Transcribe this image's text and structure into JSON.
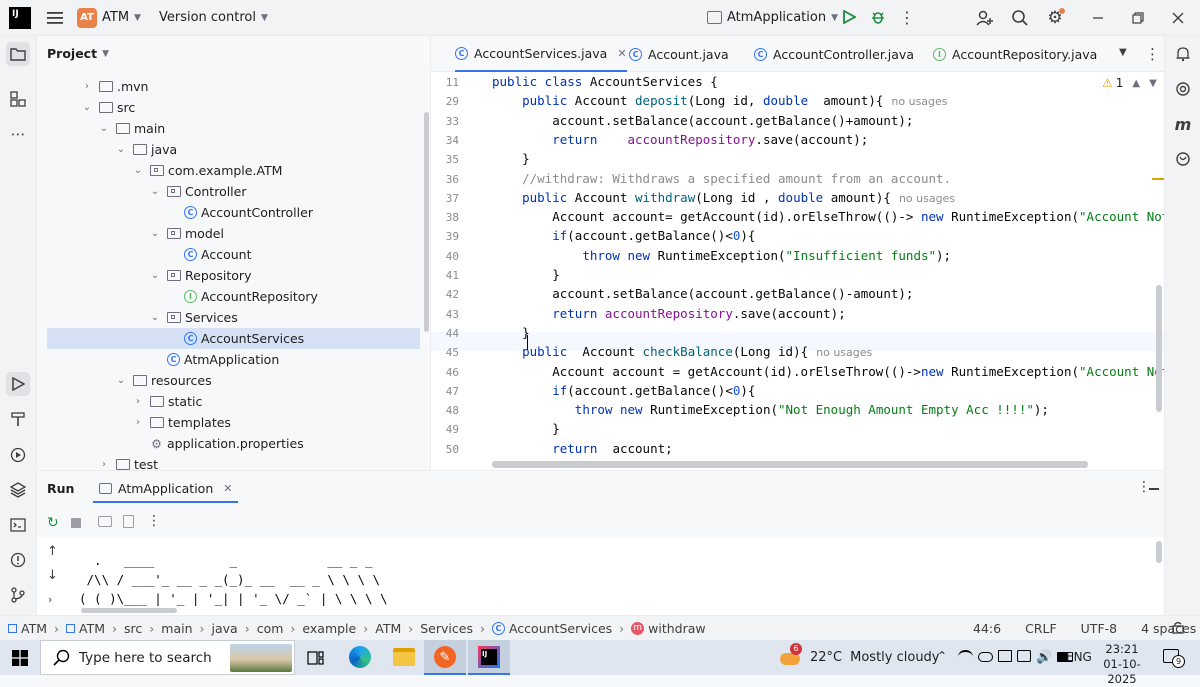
{
  "titlebar": {
    "logo": "IJ",
    "project_badge": "AT",
    "project_name": "ATM",
    "vcs": "Version control",
    "run_config": "AtmApplication"
  },
  "project_panel": {
    "title": "Project",
    "tree": [
      {
        "label": ".mvn",
        "type": "folder",
        "indent": 0,
        "open": false
      },
      {
        "label": "src",
        "type": "folder",
        "indent": 0,
        "open": true
      },
      {
        "label": "main",
        "type": "folder",
        "indent": 1,
        "open": true
      },
      {
        "label": "java",
        "type": "folder",
        "indent": 2,
        "open": true
      },
      {
        "label": "com.example.ATM",
        "type": "package",
        "indent": 3,
        "open": true
      },
      {
        "label": "Controller",
        "type": "package",
        "indent": 4,
        "open": true
      },
      {
        "label": "AccountController",
        "type": "class",
        "indent": 5
      },
      {
        "label": "model",
        "type": "package",
        "indent": 4,
        "open": true
      },
      {
        "label": "Account",
        "type": "class",
        "indent": 5
      },
      {
        "label": "Repository",
        "type": "package",
        "indent": 4,
        "open": true
      },
      {
        "label": "AccountRepository",
        "type": "interface",
        "indent": 5
      },
      {
        "label": "Services",
        "type": "package",
        "indent": 4,
        "open": true
      },
      {
        "label": "AccountServices",
        "type": "class",
        "indent": 5,
        "selected": true
      },
      {
        "label": "AtmApplication",
        "type": "class",
        "indent": 4
      },
      {
        "label": "resources",
        "type": "folder",
        "indent": 2,
        "open": true
      },
      {
        "label": "static",
        "type": "folder",
        "indent": 3
      },
      {
        "label": "templates",
        "type": "folder",
        "indent": 3
      },
      {
        "label": "application.properties",
        "type": "gear",
        "indent": 3
      },
      {
        "label": "test",
        "type": "folder",
        "indent": 1,
        "open": false
      }
    ]
  },
  "tabs": [
    {
      "label": "AccountServices.java",
      "icon": "class",
      "active": true
    },
    {
      "label": "Account.java",
      "icon": "class"
    },
    {
      "label": "AccountController.java",
      "icon": "class"
    },
    {
      "label": "AccountRepository.java",
      "icon": "interface"
    }
  ],
  "editor": {
    "warning_count": "1",
    "lines": [
      {
        "n": "11",
        "segs": [
          [
            "kw",
            "public class "
          ],
          [
            "",
            "AccountServices {"
          ]
        ]
      },
      {
        "n": "29",
        "segs": [
          [
            "",
            "    "
          ],
          [
            "kw",
            "public "
          ],
          [
            "",
            "Account "
          ],
          [
            "fn",
            "deposit"
          ],
          [
            "",
            "(Long id, "
          ],
          [
            "kw",
            "double  "
          ],
          [
            "",
            "amount){"
          ],
          [
            "hint",
            "no usages"
          ]
        ]
      },
      {
        "n": "33",
        "segs": [
          [
            "",
            "        account.setBalance(account.getBalance()+amount);"
          ]
        ]
      },
      {
        "n": "34",
        "segs": [
          [
            "",
            "        "
          ],
          [
            "kw",
            "return    "
          ],
          [
            "fld",
            "accountRepository"
          ],
          [
            "",
            ".save(account);"
          ]
        ]
      },
      {
        "n": "35",
        "segs": [
          [
            "",
            "    }"
          ]
        ]
      },
      {
        "n": "36",
        "segs": [
          [
            "cm",
            "    //withdraw: Withdraws a specified amount from an account."
          ]
        ]
      },
      {
        "n": "37",
        "segs": [
          [
            "",
            "    "
          ],
          [
            "kw",
            "public "
          ],
          [
            "",
            "Account "
          ],
          [
            "fn",
            "withdraw"
          ],
          [
            "",
            "(Long id , "
          ],
          [
            "kw",
            "double "
          ],
          [
            "",
            "amount){"
          ],
          [
            "hint",
            "no usages"
          ]
        ]
      },
      {
        "n": "38",
        "segs": [
          [
            "",
            "        Account account= getAccount(id).orElseThrow(()-> "
          ],
          [
            "kw",
            "new "
          ],
          [
            "",
            "RuntimeException("
          ],
          [
            "str",
            "\"Account Not Found"
          ]
        ]
      },
      {
        "n": "39",
        "segs": [
          [
            "",
            "        "
          ],
          [
            "kw",
            "if"
          ],
          [
            "",
            "(account.getBalance()<"
          ],
          [
            "num",
            "0"
          ],
          [
            "",
            "){"
          ]
        ]
      },
      {
        "n": "40",
        "segs": [
          [
            "",
            "            "
          ],
          [
            "kw",
            "throw new "
          ],
          [
            "",
            "RuntimeException("
          ],
          [
            "str",
            "\"Insufficient funds\""
          ],
          [
            "",
            ");"
          ]
        ]
      },
      {
        "n": "41",
        "segs": [
          [
            "",
            "        }"
          ]
        ]
      },
      {
        "n": "42",
        "segs": [
          [
            "",
            "        account.setBalance(account.getBalance()-amount);"
          ]
        ]
      },
      {
        "n": "43",
        "segs": [
          [
            "",
            "        "
          ],
          [
            "kw",
            "return "
          ],
          [
            "fld",
            "accountRepository"
          ],
          [
            "",
            ".save(account);"
          ]
        ]
      },
      {
        "n": "44",
        "segs": [
          [
            "",
            "    }"
          ]
        ]
      },
      {
        "n": "45",
        "segs": [
          [
            "",
            "    "
          ],
          [
            "kw",
            "public  "
          ],
          [
            "",
            "Account "
          ],
          [
            "fn",
            "checkBalance"
          ],
          [
            "",
            "(Long id){"
          ],
          [
            "hint",
            "no usages"
          ]
        ]
      },
      {
        "n": "46",
        "segs": [
          [
            "",
            "        Account account = getAccount(id).orElseThrow(()->"
          ],
          [
            "kw",
            "new "
          ],
          [
            "",
            "RuntimeException("
          ],
          [
            "str",
            "\"Account Not Found"
          ]
        ]
      },
      {
        "n": "47",
        "segs": [
          [
            "",
            "        "
          ],
          [
            "kw",
            "if"
          ],
          [
            "",
            "(account.getBalance()<"
          ],
          [
            "num",
            "0"
          ],
          [
            "",
            "){"
          ]
        ]
      },
      {
        "n": "48",
        "segs": [
          [
            "",
            "           "
          ],
          [
            "kw",
            "throw new "
          ],
          [
            "",
            "RuntimeException("
          ],
          [
            "str",
            "\"Not Enough Amount Empty Acc !!!!\""
          ],
          [
            "",
            ");"
          ]
        ]
      },
      {
        "n": "49",
        "segs": [
          [
            "",
            "        }"
          ]
        ]
      },
      {
        "n": "50",
        "segs": [
          [
            "",
            "        "
          ],
          [
            "kw",
            "return  "
          ],
          [
            "",
            "account;"
          ]
        ]
      }
    ]
  },
  "run_panel": {
    "title": "Run",
    "tab": "AtmApplication",
    "console": [
      "  .   ____          _            __ _ _",
      " /\\\\ / ___'_ __ _ _(_)_ __  __ _ \\ \\ \\ \\",
      "( ( )\\___ | '_ | '_| | '_ \\/ _` | \\ \\ \\ \\"
    ]
  },
  "statusbar": {
    "breadcrumb": [
      "ATM",
      "ATM",
      "src",
      "main",
      "java",
      "com",
      "example",
      "ATM",
      "Services",
      "AccountServices",
      "withdraw"
    ],
    "position": "44:6",
    "line_sep": "CRLF",
    "encoding": "UTF-8",
    "indent": "4 spaces"
  },
  "taskbar": {
    "search_placeholder": "Type here to search",
    "weather_badge": "6",
    "weather_temp": "22°C",
    "weather_desc": "Mostly cloudy",
    "lang": "ENG",
    "time": "23:21",
    "date": "01-10-2025",
    "notif_count": "9"
  }
}
